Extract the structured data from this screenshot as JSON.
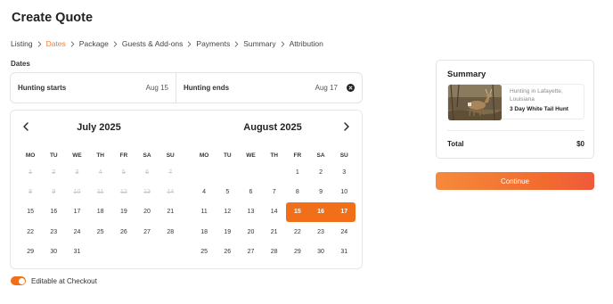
{
  "page": {
    "title": "Create Quote"
  },
  "breadcrumbs": [
    {
      "label": "Listing",
      "active": false
    },
    {
      "label": "Dates",
      "active": true
    },
    {
      "label": "Package",
      "active": false
    },
    {
      "label": "Guests & Add-ons",
      "active": false
    },
    {
      "label": "Payments",
      "active": false
    },
    {
      "label": "Summary",
      "active": false
    },
    {
      "label": "Attribution",
      "active": false
    }
  ],
  "dates": {
    "section_label": "Dates",
    "start_label": "Hunting starts",
    "start_value": "Aug 15",
    "end_label": "Hunting ends",
    "end_value": "Aug 17"
  },
  "calendar": {
    "weekdays": [
      "MO",
      "TU",
      "WE",
      "TH",
      "FR",
      "SA",
      "SU"
    ],
    "months": [
      {
        "title": "July 2025",
        "leading_blanks": 0,
        "days": 31,
        "disabled_through": 14,
        "selected": []
      },
      {
        "title": "August 2025",
        "leading_blanks": 4,
        "days": 31,
        "disabled_through": 0,
        "selected": [
          15,
          16,
          17
        ]
      }
    ]
  },
  "toggle": {
    "label": "Editable at Checkout",
    "on": true
  },
  "summary": {
    "title": "Summary",
    "item_location": "Hunting in Lafayette, Louisiana",
    "item_name": "3 Day White Tail Hunt",
    "total_label": "Total",
    "total_value": "$0"
  },
  "actions": {
    "continue_label": "Continue"
  },
  "colors": {
    "accent": "#f26f1a",
    "active_crumb": "#f47a32"
  },
  "icons": {
    "prev": "chevron-left-icon",
    "next": "chevron-right-icon",
    "clear": "close-circle-icon",
    "crumb_sep": "chevron-right-icon"
  }
}
